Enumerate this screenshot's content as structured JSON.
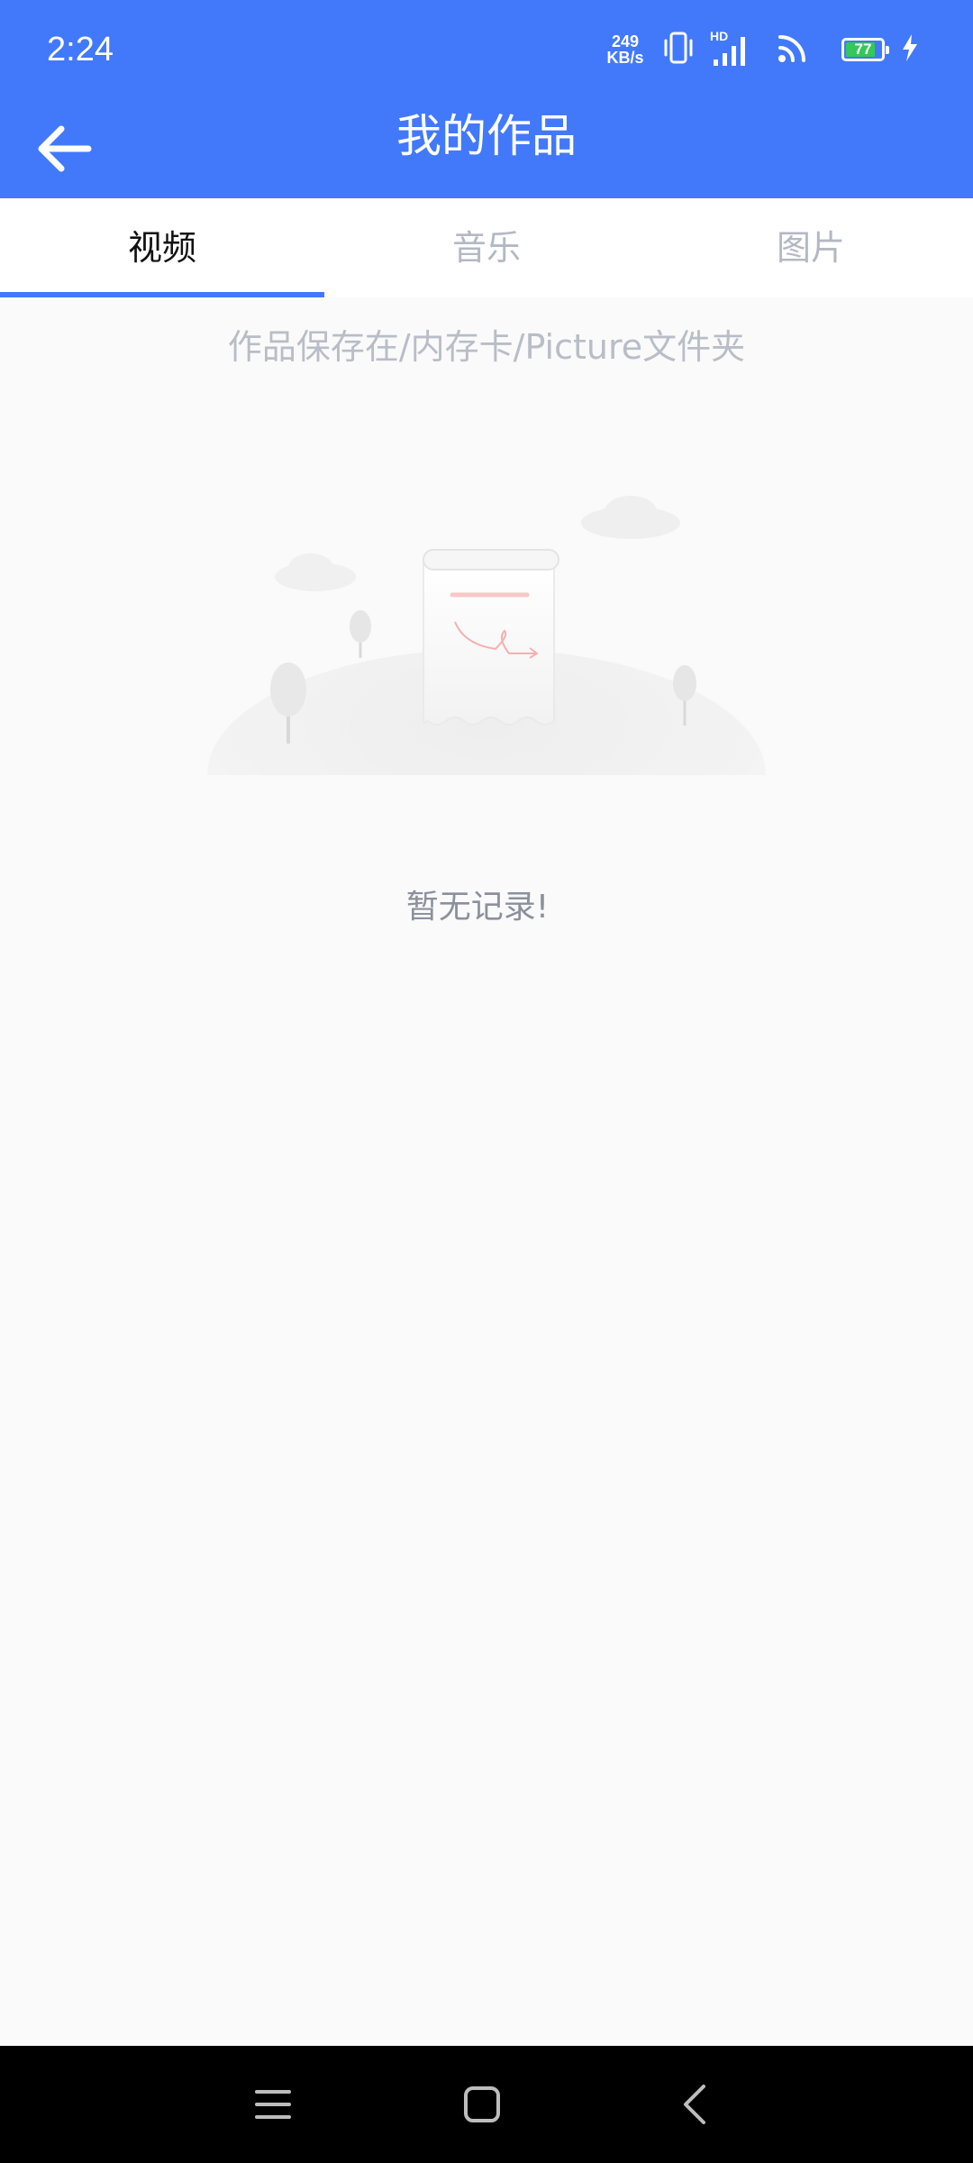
{
  "status_bar": {
    "time": "2:24",
    "net_speed_value": "249",
    "net_speed_unit": "KB/s",
    "signal_label": "HD",
    "battery_level": "77",
    "battery_color": "#34c759",
    "icons": [
      "vibrate-icon",
      "signal-icon",
      "wifi-icon",
      "battery-icon",
      "charging-icon"
    ]
  },
  "header": {
    "title": "我的作品",
    "background_color": "#4279fb"
  },
  "tabs": [
    {
      "label": "视频",
      "active": true
    },
    {
      "label": "音乐",
      "active": false
    },
    {
      "label": "图片",
      "active": false
    }
  ],
  "hint": "作品保存在/内存卡/Picture文件夹",
  "empty_state": {
    "message": "暂无记录!",
    "illustration": "empty-scroll-illustration"
  },
  "nav_bar": {
    "buttons": [
      "menu-icon",
      "home-icon",
      "back-icon"
    ]
  }
}
